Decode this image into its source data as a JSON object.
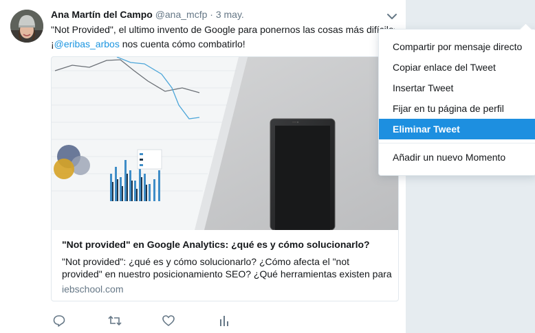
{
  "tweet": {
    "fullname": "Ana Martín del Campo",
    "username": "@ana_mcfp",
    "separator": "·",
    "time": "3 may.",
    "text_line1": "\"Not Provided\", el ultimo invento de Google para ponernos las cosas más difíciles.",
    "text_line2_prefix": "¡",
    "mention": "@eribas_arbos",
    "text_line2_suffix": " nos cuenta cómo combatirlo!"
  },
  "card": {
    "title": "\"Not provided\" en Google Analytics: ¿qué es y cómo solucionarlo?",
    "description": "\"Not provided\": ¿qué es y cómo solucionarlo? ¿Cómo afecta el \"not provided\" en nuestro posicionamiento SEO? ¿Qué herramientas existen para combatirlo?",
    "domain": "iebschool.com"
  },
  "actions": {
    "reply_icon": "reply-icon",
    "retweet_icon": "retweet-icon",
    "like_icon": "heart-icon",
    "analytics_icon": "analytics-icon"
  },
  "menu": {
    "items": [
      "Compartir por mensaje directo",
      "Copiar enlace del Tweet",
      "Insertar Tweet",
      "Fijar en tu página de perfil",
      "Eliminar Tweet",
      "Añadir un nuevo Momento"
    ],
    "active_index": 4
  },
  "colors": {
    "accent": "#1d8fe0",
    "link": "#1b95e0",
    "muted": "#657786",
    "background": "#e6ecf0"
  }
}
